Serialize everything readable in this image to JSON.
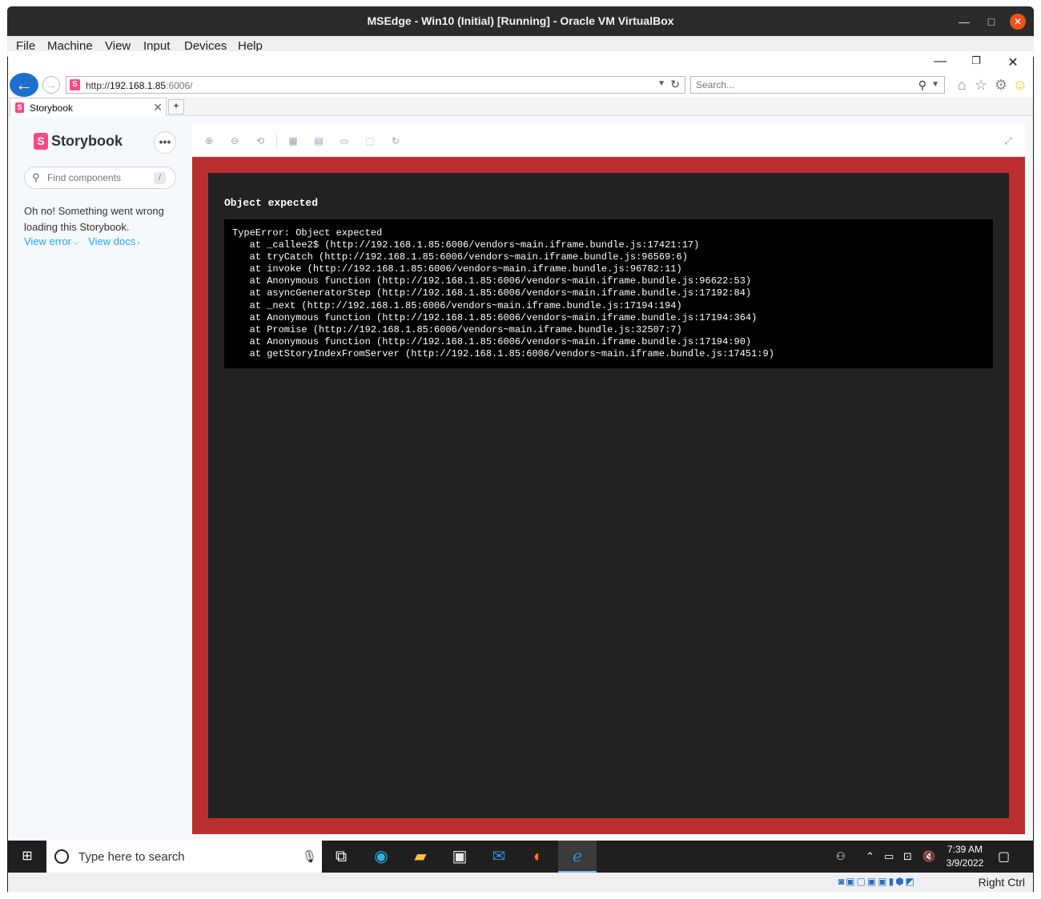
{
  "vbox": {
    "title": "MSEdge - Win10 (Initial) [Running] - Oracle VM VirtualBox",
    "menu": [
      "File",
      "Machine",
      "View",
      "Input",
      "Devices",
      "Help"
    ],
    "host_key": "Right Ctrl"
  },
  "ie": {
    "url_prefix": "http://",
    "url_host": "192.168.1.85",
    "url_port": ":6006/",
    "search_placeholder": "Search...",
    "tab_label": "Storybook"
  },
  "storybook": {
    "logo_text": "Storybook",
    "menu_label": "•••",
    "search_placeholder": "Find components",
    "search_shortcut": "/",
    "error_message": "Oh no! Something went wrong loading this Storybook.",
    "view_error": "View error",
    "view_docs": "View docs"
  },
  "preview": {
    "error_title": "Object expected",
    "stack": [
      "TypeError: Object expected",
      "   at _callee2$ (http://192.168.1.85:6006/vendors~main.iframe.bundle.js:17421:17)",
      "   at tryCatch (http://192.168.1.85:6006/vendors~main.iframe.bundle.js:96569:6)",
      "   at invoke (http://192.168.1.85:6006/vendors~main.iframe.bundle.js:96782:11)",
      "   at Anonymous function (http://192.168.1.85:6006/vendors~main.iframe.bundle.js:96622:53)",
      "   at asyncGeneratorStep (http://192.168.1.85:6006/vendors~main.iframe.bundle.js:17192:84)",
      "   at _next (http://192.168.1.85:6006/vendors~main.iframe.bundle.js:17194:194)",
      "   at Anonymous function (http://192.168.1.85:6006/vendors~main.iframe.bundle.js:17194:364)",
      "   at Promise (http://192.168.1.85:6006/vendors~main.iframe.bundle.js:32507:7)",
      "   at Anonymous function (http://192.168.1.85:6006/vendors~main.iframe.bundle.js:17194:90)",
      "   at getStoryIndexFromServer (http://192.168.1.85:6006/vendors~main.iframe.bundle.js:17451:9)"
    ]
  },
  "taskbar": {
    "search_placeholder": "Type here to search",
    "time": "7:39 AM",
    "date": "3/9/2022"
  },
  "colors": {
    "storybook_pink": "#ff4785",
    "error_red": "#b92f30",
    "link_blue": "#1ea7fd"
  }
}
